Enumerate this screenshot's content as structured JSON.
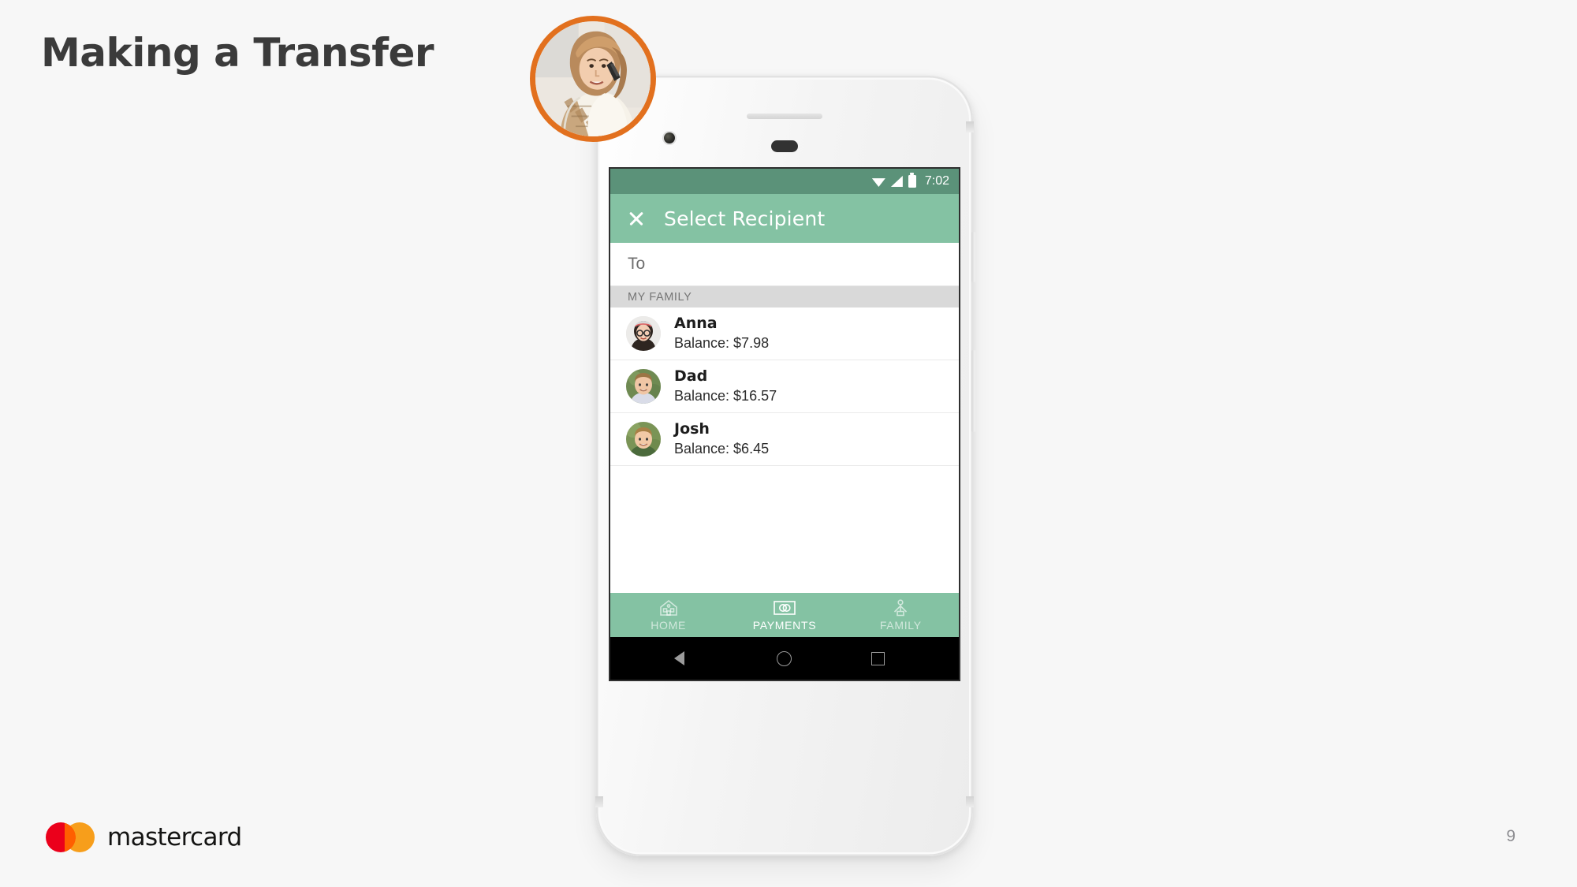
{
  "slide": {
    "title": "Making a Transfer",
    "page_number": "9",
    "brand": {
      "name": "mastercard",
      "red": "#eb001b",
      "amber": "#f79e1b",
      "overlap": "#ff5f00"
    },
    "accent_ring_color": "#e2701e",
    "background": "#f7f7f7"
  },
  "phone": {
    "status_bar": {
      "time": "7:02",
      "background": "#5b9279",
      "icons": [
        "wifi-icon",
        "signal-icon",
        "battery-icon"
      ]
    },
    "app_bar": {
      "background": "#84c2a3",
      "close_icon": "close-icon",
      "title": "Select Recipient"
    },
    "to_field": {
      "placeholder": "To",
      "value": ""
    },
    "section_header": {
      "label": "MY FAMILY",
      "background": "#d9d9d9"
    },
    "contacts": [
      {
        "name": "Anna",
        "balance": "Balance: $7.98",
        "avatar": "anna-avatar"
      },
      {
        "name": "Dad",
        "balance": "Balance: $16.57",
        "avatar": "dad-avatar"
      },
      {
        "name": "Josh",
        "balance": "Balance: $6.45",
        "avatar": "josh-avatar"
      }
    ],
    "bottom_nav": {
      "background": "#84c2a3",
      "items": [
        {
          "label": "HOME",
          "icon": "home-icon",
          "active": false
        },
        {
          "label": "PAYMENTS",
          "icon": "card-icon",
          "active": true
        },
        {
          "label": "FAMILY",
          "icon": "person-icon",
          "active": false
        }
      ]
    },
    "android_nav": {
      "back": "back-triangle-icon",
      "home": "home-circle-icon",
      "recents": "recents-square-icon"
    }
  }
}
